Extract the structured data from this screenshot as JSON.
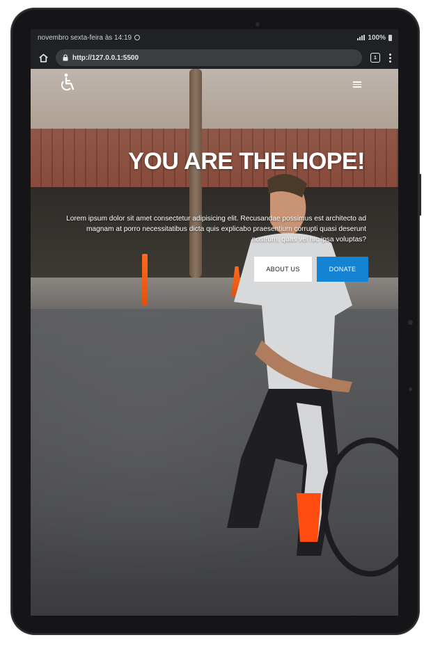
{
  "status_bar": {
    "time_text": "novembro sexta-feira às 14:19",
    "battery": "100%"
  },
  "browser": {
    "url": "http://127.0.0.1:5500",
    "tab_count": "1",
    "icons": [
      "home-icon",
      "lock-icon",
      "tabs-icon",
      "menu-kebab-icon"
    ]
  },
  "hero": {
    "title": "YOU ARE THE HOPE!",
    "paragraph": "Lorem ipsum dolor sit amet consectetur adipisicing elit. Recusandae possimus est architecto ad magnam at porro necessitatibus dicta quis explicabo praesentium corrupti quasi deserunt nostrum, quas vel hic ipsa voluptas?",
    "about_button": "ABOUT US",
    "donate_button": "DONATE"
  },
  "nav": {
    "logo_icon": "wheelchair-icon",
    "menu_icon": "hamburger-icon"
  },
  "colors": {
    "donate_accent": "#1583d4",
    "browser_bg": "#202124"
  }
}
